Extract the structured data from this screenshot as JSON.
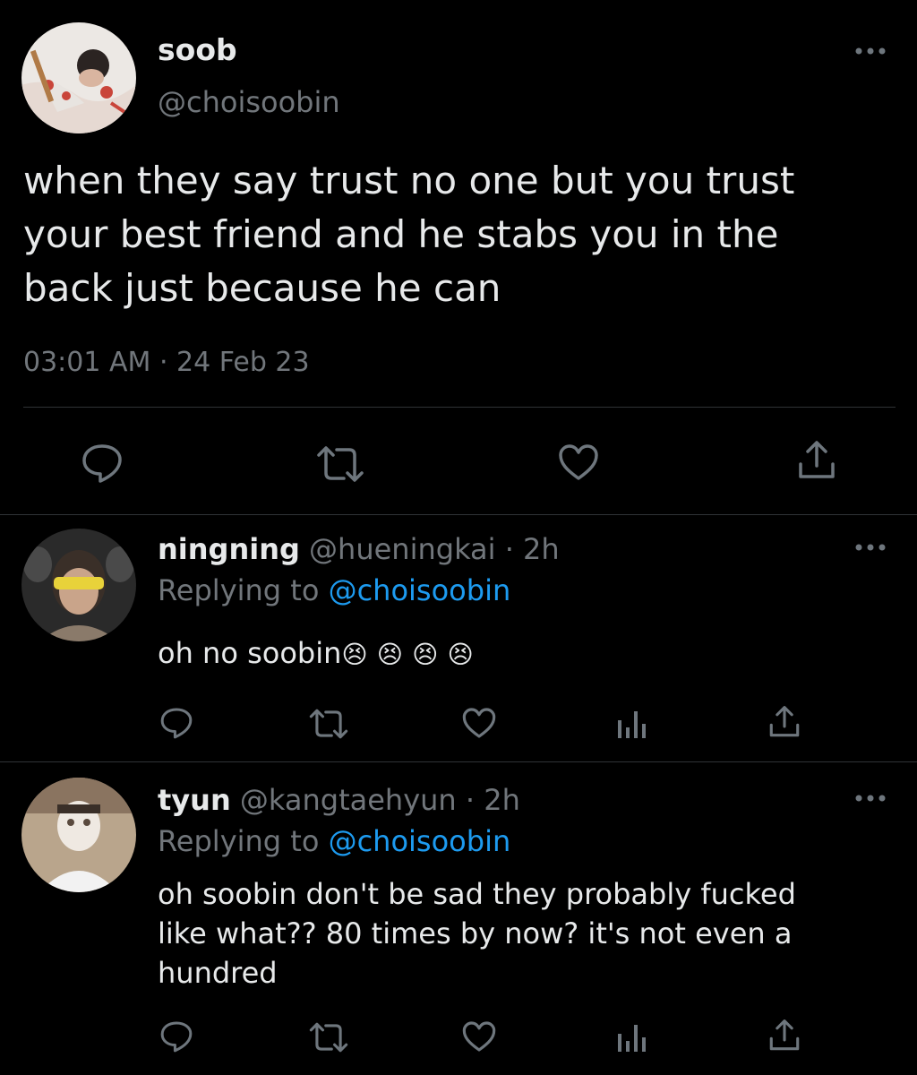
{
  "main_tweet": {
    "display_name": "soob",
    "handle": "@choisoobin",
    "text_lines": [
      "when they say trust no one but you trust",
      "your best friend and he stabs you in the",
      "back just because he can"
    ],
    "time": "03:01 AM",
    "separator": "·",
    "date": "24 Feb 23"
  },
  "replies": [
    {
      "display_name": "ningning",
      "handle": "@hueningkai",
      "age": "· 2h",
      "replying_prefix": "Replying to",
      "replying_handle": "@choisoobin",
      "text": "oh no soobin",
      "emojis": [
        "😣",
        "😣",
        "😣",
        "😣"
      ]
    },
    {
      "display_name": "tyun",
      "handle": "@kangtaehyun",
      "age": "· 2h",
      "replying_prefix": "Replying to",
      "replying_handle": "@choisoobin",
      "text_lines": [
        "oh soobin don't be sad they probably fucked",
        "like what?? 80 times by now? it's not even a",
        "hundred"
      ]
    }
  ],
  "colors": {
    "background": "#000000",
    "text": "#e7e9ea",
    "secondary": "#71767b",
    "accent": "#1d9bf0",
    "divider": "#2f3336"
  },
  "icons": [
    "reply-icon",
    "retweet-icon",
    "like-icon",
    "share-icon",
    "analytics-icon",
    "more-icon"
  ]
}
